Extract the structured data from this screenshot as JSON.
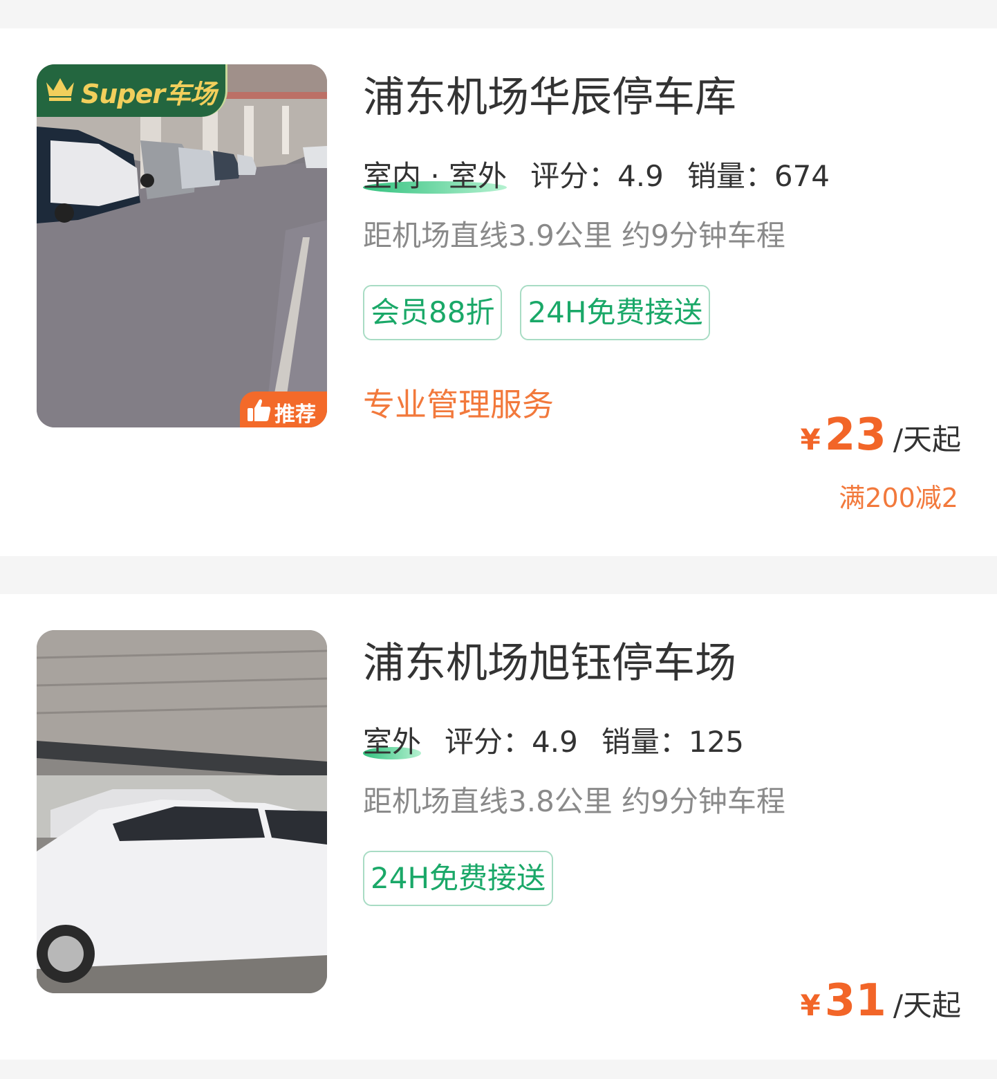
{
  "lots": [
    {
      "name": "浦东机场华辰停车库",
      "environment": "室内 · 室外",
      "rating_label": "评分：4.9",
      "sales_label": "销量：674",
      "distance": "距机场直线3.9公里 约9分钟车程",
      "tags": [
        "会员88折",
        "24H免费接送"
      ],
      "service": "专业管理服务",
      "price_symbol": "¥",
      "price": "23",
      "price_unit": "/天起",
      "promo": "满200减2",
      "super_badge": "Super车场",
      "recommend_badge": "推荐"
    },
    {
      "name": "浦东机场旭钰停车场",
      "environment": "室外",
      "rating_label": "评分：4.9",
      "sales_label": "销量：125",
      "distance": "距机场直线3.8公里 约9分钟车程",
      "tags": [
        "24H免费接送"
      ],
      "price_symbol": "¥",
      "price": "31",
      "price_unit": "/天起"
    }
  ],
  "colors": {
    "accent_green": "#1aa868",
    "price_orange": "#f26528",
    "super_badge_bg": "#23663f",
    "super_badge_text": "#f2cf5c",
    "recommend_badge_bg": "#f36a2a"
  },
  "icons": [
    "crown-icon",
    "thumbs-up-icon"
  ]
}
